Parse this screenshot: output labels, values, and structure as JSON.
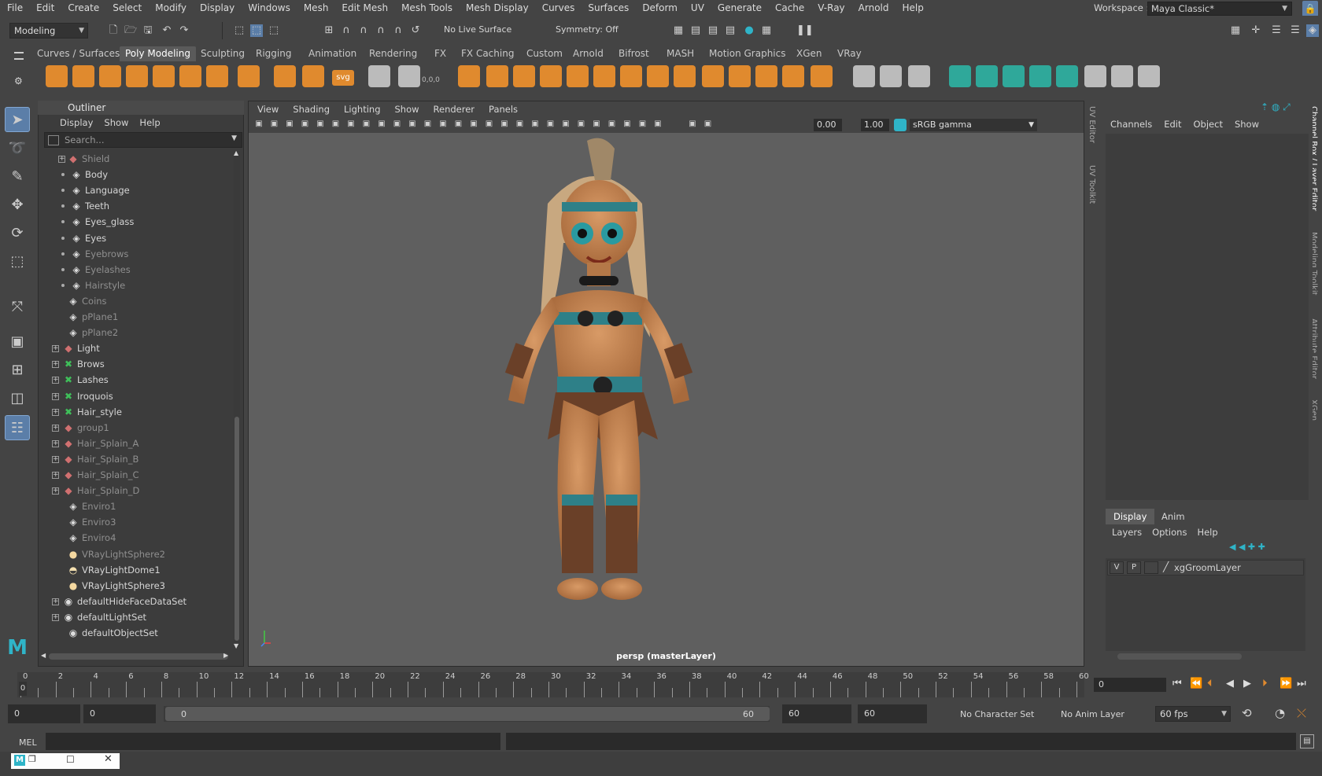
{
  "menubar": {
    "items": [
      "File",
      "Edit",
      "Create",
      "Select",
      "Modify",
      "Display",
      "Windows",
      "Mesh",
      "Edit Mesh",
      "Mesh Tools",
      "Mesh Display",
      "Curves",
      "Surfaces",
      "Deform",
      "UV",
      "Generate",
      "Cache",
      "V-Ray",
      "Arnold",
      "Help"
    ],
    "workspace_label": "Workspace :",
    "workspace_value": "Maya Classic*"
  },
  "statusline": {
    "menuset": "Modeling",
    "live_surface": "No Live Surface",
    "symmetry": "Symmetry: Off"
  },
  "shelf": {
    "tabs": [
      "Curves / Surfaces",
      "Poly Modeling",
      "Sculpting",
      "Rigging",
      "Animation",
      "Rendering",
      "FX",
      "FX Caching",
      "Custom",
      "Arnold",
      "Bifrost",
      "MASH",
      "Motion Graphics",
      "XGen",
      "VRay"
    ],
    "active_tab": "Poly Modeling",
    "svg_label": "svg",
    "xyz_label": "0,0,0"
  },
  "outliner": {
    "title": "Outliner",
    "menu": [
      "Display",
      "Show",
      "Help"
    ],
    "search_placeholder": "Search...",
    "items": [
      {
        "label": "Shield",
        "dim": true
      },
      {
        "label": "Body",
        "dim": false
      },
      {
        "label": "Language",
        "dim": false
      },
      {
        "label": "Teeth",
        "dim": false
      },
      {
        "label": "Eyes_glass",
        "dim": false
      },
      {
        "label": "Eyes",
        "dim": false
      },
      {
        "label": "Eyebrows",
        "dim": true
      },
      {
        "label": "Eyelashes",
        "dim": true
      },
      {
        "label": "Hairstyle",
        "dim": true
      },
      {
        "label": "Coins",
        "dim": true
      },
      {
        "label": "pPlane1",
        "dim": true
      },
      {
        "label": "pPlane2",
        "dim": true
      },
      {
        "label": "Light",
        "dim": false
      },
      {
        "label": "Brows",
        "dim": false
      },
      {
        "label": "Lashes",
        "dim": false
      },
      {
        "label": "Iroquois",
        "dim": false
      },
      {
        "label": "Hair_style",
        "dim": false
      },
      {
        "label": "group1",
        "dim": true
      },
      {
        "label": "Hair_Splain_A",
        "dim": true
      },
      {
        "label": "Hair_Splain_B",
        "dim": true
      },
      {
        "label": "Hair_Splain_C",
        "dim": true
      },
      {
        "label": "Hair_Splain_D",
        "dim": true
      },
      {
        "label": "Enviro1",
        "dim": true
      },
      {
        "label": "Enviro3",
        "dim": true
      },
      {
        "label": "Enviro4",
        "dim": true
      },
      {
        "label": "VRayLightSphere2",
        "dim": true
      },
      {
        "label": "VRayLightDome1",
        "dim": false
      },
      {
        "label": "VRayLightSphere3",
        "dim": false
      },
      {
        "label": "defaultHideFaceDataSet",
        "dim": false
      },
      {
        "label": "defaultLightSet",
        "dim": false
      },
      {
        "label": "defaultObjectSet",
        "dim": false
      }
    ]
  },
  "viewport": {
    "menu": [
      "View",
      "Shading",
      "Lighting",
      "Show",
      "Renderer",
      "Panels"
    ],
    "exposure": "0.00",
    "gamma": "1.00",
    "colorspace": "sRGB gamma",
    "camera_label": "persp (masterLayer)"
  },
  "side_tabs": {
    "left": [
      "UV Editor",
      "UV Toolkit"
    ],
    "right": [
      "Channel Box / Layer Editor",
      "Modeling Toolkit",
      "Attribute Editor",
      "XGen"
    ]
  },
  "channelbox": {
    "menu": [
      "Channels",
      "Edit",
      "Object",
      "Show"
    ]
  },
  "layer_editor": {
    "tabs": [
      "Display",
      "Anim"
    ],
    "menu": [
      "Layers",
      "Options",
      "Help"
    ],
    "layer": {
      "v": "V",
      "p": "P",
      "name": "xgGroomLayer"
    }
  },
  "timeslider": {
    "ticks": [
      "0",
      "2",
      "4",
      "6",
      "8",
      "10",
      "12",
      "14",
      "16",
      "18",
      "20",
      "22",
      "24",
      "26",
      "28",
      "30",
      "32",
      "34",
      "36",
      "38",
      "40",
      "42",
      "44",
      "46",
      "48",
      "50",
      "52",
      "54",
      "56",
      "58",
      "60"
    ],
    "current": "0",
    "frame_field": "0"
  },
  "range": {
    "start": "0",
    "anim_start": "0",
    "slider_start": "0",
    "slider_end": "60",
    "anim_end": "60",
    "end": "60",
    "character_set": "No Character Set",
    "anim_layer": "No Anim Layer",
    "fps": "60 fps"
  },
  "cmdline": {
    "label": "MEL"
  }
}
